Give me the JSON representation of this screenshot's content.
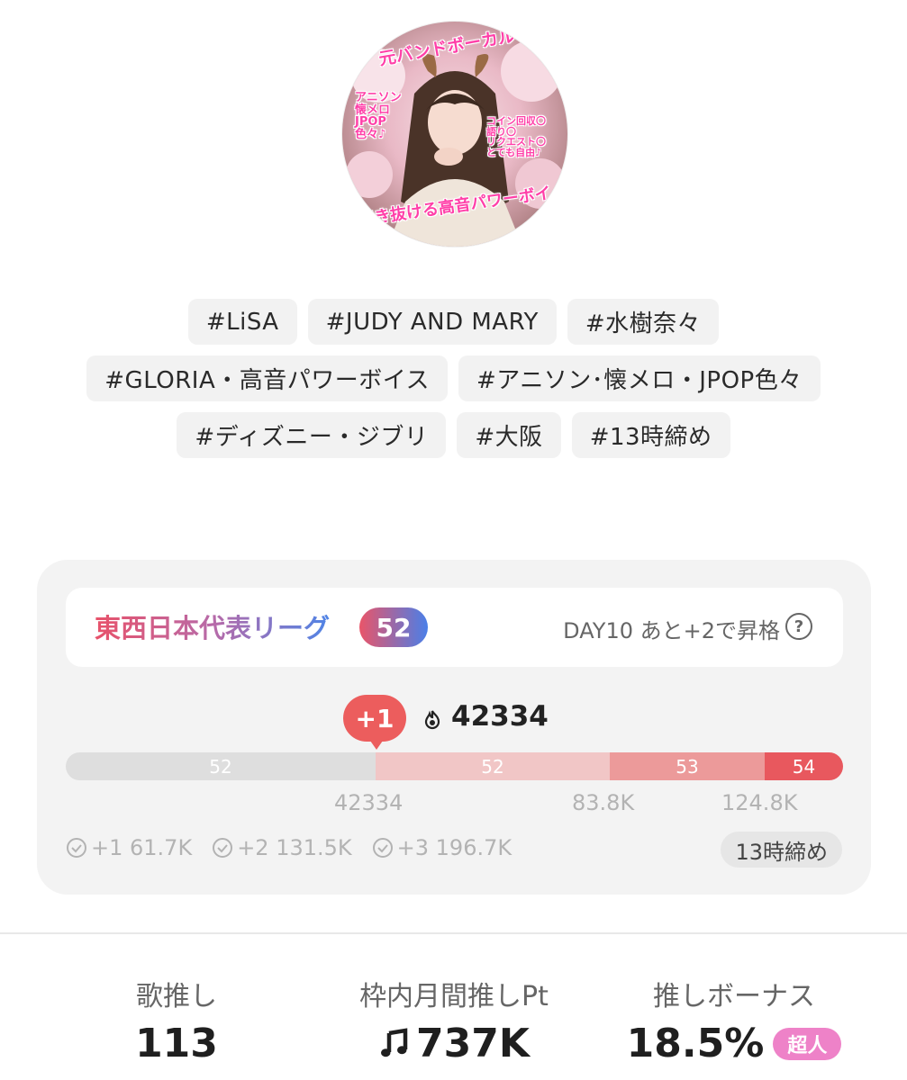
{
  "profile": {
    "avatar_text": {
      "top": "元バンドボーカル",
      "left": [
        "アニソン",
        "懐メロ",
        "JPOP",
        "色々♪"
      ],
      "right": [
        "コイン回収〇",
        "語り〇",
        "リクエスト〇",
        "とても自由♪"
      ],
      "bottom": "突き抜ける高音パワーボイス"
    }
  },
  "tags": [
    [
      "#LiSA",
      "#JUDY AND MARY",
      "#水樹奈々"
    ],
    [
      "#GLORIA・高音パワーボイス",
      "#アニソン･懐メロ・JPOP色々"
    ],
    [
      "#ディズニー・ジブリ",
      "#大阪",
      "#13時締め"
    ]
  ],
  "league": {
    "name": "東西日本代表リーグ",
    "rank": "52",
    "status": "DAY10 あと+2で昇格",
    "help_icon": "?",
    "delta": "+1",
    "score": "42334",
    "segments": [
      "52",
      "52",
      "53",
      "54"
    ],
    "marks": [
      "42334",
      "83.8K",
      "124.8K"
    ],
    "thresholds": [
      "+1 61.7K",
      "+2 131.5K",
      "+3 196.7K"
    ],
    "deadline": "13時締め",
    "colors": {
      "accent": "#ec5d5d",
      "gradient_start": "#e8526a",
      "gradient_end": "#4f84e6"
    }
  },
  "stats": {
    "song_label": "歌推し",
    "song_value": "113",
    "points_label": "枠内月間推しPt",
    "points_value": "737K",
    "bonus_label": "推しボーナス",
    "bonus_value": "18.5%",
    "bonus_badge": "超人"
  }
}
